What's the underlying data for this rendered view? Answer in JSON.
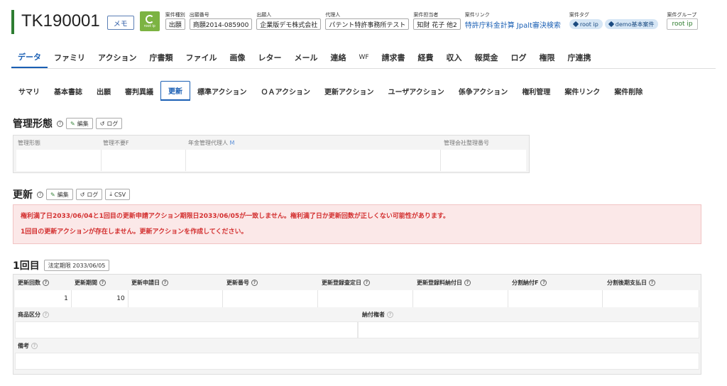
{
  "header": {
    "case_id": "TK190001",
    "memo_label": "メモ",
    "logo_text": "root ip",
    "case_type_label": "案件種別",
    "case_type": "出願",
    "app_number_label": "出願番号",
    "app_number": "商願2014-085900",
    "applicant_label": "出願人",
    "applicant": "企業版デモ株式会社",
    "agent_label": "代理人",
    "agent": "パテント特許事務所テスト",
    "person_label": "案件担当者",
    "person": "知財 花子 他2",
    "link_label": "案件リンク",
    "link1": "特許庁料金計算",
    "link2": "Jpalt審決検索",
    "tag_label": "案件タグ",
    "tag1": "root ip",
    "tag2": "demo基本案件",
    "group_label": "案件グループ",
    "group": "root ip"
  },
  "nav1": [
    "データ",
    "ファミリ",
    "アクション",
    "庁書類",
    "ファイル",
    "画像",
    "レター",
    "メール",
    "連絡",
    "WF",
    "請求書",
    "経費",
    "収入",
    "報奨金",
    "ログ",
    "権限",
    "庁連携"
  ],
  "nav2": [
    "サマリ",
    "基本書誌",
    "出願",
    "審判異議",
    "更新",
    "標準アクション",
    "ＯＡアクション",
    "更新アクション",
    "ユーザアクション",
    "係争アクション",
    "権利管理",
    "案件リンク",
    "案件削除"
  ],
  "mgmt": {
    "title": "管理形態",
    "edit": "編集",
    "log": "ログ",
    "cols": [
      "管理形態",
      "管理不要F",
      "年金管理代理人",
      "管理会社整理番号"
    ],
    "m_mark": "M"
  },
  "renewal": {
    "title": "更新",
    "edit": "編集",
    "log": "ログ",
    "csv": "CSV",
    "err1": "権利満了日2033/06/04と1回目の更新申請アクション期限日2033/06/05が一致しません。権利満了日か更新回数が正しくない可能性があります。",
    "err2": "1回目の更新アクションが存在しません。更新アクションを作成してください。"
  },
  "round1": {
    "title": "1回目",
    "deadline": "法定期限 2033/06/05",
    "cols": [
      "更新回数",
      "更新期間",
      "更新申請日",
      "更新番号",
      "更新登録査定日",
      "更新登録料納付日",
      "分割納付F",
      "分割後期支払日"
    ],
    "values": [
      "1",
      "10",
      "",
      "",
      "",
      "",
      "",
      ""
    ],
    "goods_label": "商品区分",
    "payer_label": "納付権者",
    "notes_label": "備考"
  }
}
